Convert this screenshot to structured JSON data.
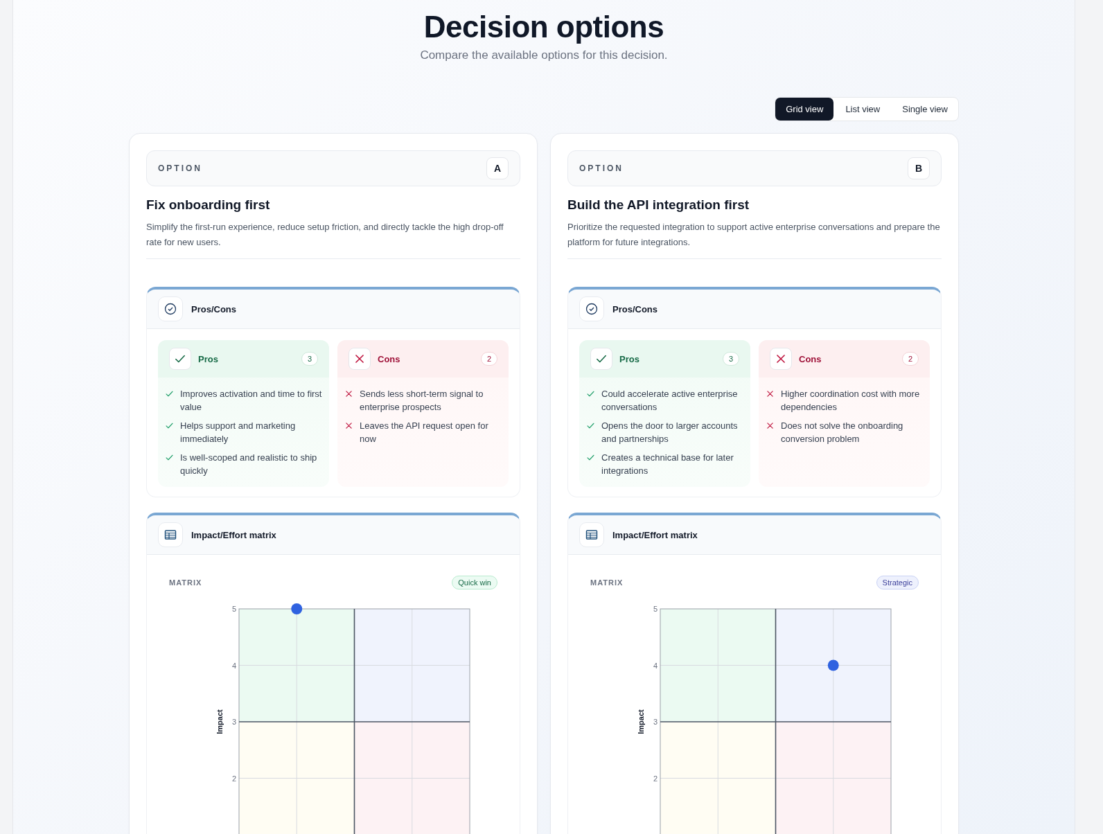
{
  "header": {
    "title": "Decision options",
    "subtitle": "Compare the available options for this decision."
  },
  "view_tabs": [
    {
      "label": "Grid view",
      "selected": true
    },
    {
      "label": "List view",
      "selected": false
    },
    {
      "label": "Single view",
      "selected": false
    }
  ],
  "options": [
    {
      "eyebrow": "OPTION",
      "letter": "A",
      "title": "Fix onboarding first",
      "description": "Simplify the first-run experience, reduce setup friction, and directly tackle the high drop-off rate for new users.",
      "pros_cons": {
        "title": "Pros/Cons",
        "pros": {
          "label": "Pros",
          "count": "3",
          "items": [
            "Improves activation and time to first value",
            "Helps support and marketing immediately",
            "Is well-scoped and realistic to ship quickly"
          ]
        },
        "cons": {
          "label": "Cons",
          "count": "2",
          "items": [
            "Sends less short-term signal to enterprise prospects",
            "Leaves the API request open for now"
          ]
        }
      },
      "matrix": {
        "title": "Impact/Effort matrix",
        "label": "MATRIX",
        "badge": {
          "text": "Quick win",
          "kind": "quick-win"
        },
        "chart_data": {
          "type": "scatter",
          "ylabel": "Impact",
          "categories": [
            null,
            null,
            null,
            null,
            null
          ],
          "series": [
            {
              "color": "#2f62e0",
              "values": [
                null,
                5,
                null,
                null,
                null
              ]
            }
          ],
          "ylim": [
            1,
            5
          ],
          "yticks": [
            2,
            3,
            4,
            5
          ],
          "grid": true
        }
      }
    },
    {
      "eyebrow": "OPTION",
      "letter": "B",
      "title": "Build the API integration first",
      "description": "Prioritize the requested integration to support active enterprise conversations and prepare the platform for future integrations.",
      "pros_cons": {
        "title": "Pros/Cons",
        "pros": {
          "label": "Pros",
          "count": "3",
          "items": [
            "Could accelerate active enterprise conversations",
            "Opens the door to larger accounts and partnerships",
            "Creates a technical base for later integrations"
          ]
        },
        "cons": {
          "label": "Cons",
          "count": "2",
          "items": [
            "Higher coordination cost with more dependencies",
            "Does not solve the onboarding conversion problem"
          ]
        }
      },
      "matrix": {
        "title": "Impact/Effort matrix",
        "label": "MATRIX",
        "badge": {
          "text": "Strategic",
          "kind": "strategic"
        },
        "chart_data": {
          "type": "scatter",
          "ylabel": "Impact",
          "categories": [
            null,
            null,
            null,
            null,
            null
          ],
          "series": [
            {
              "color": "#2f62e0",
              "values": [
                null,
                null,
                null,
                4,
                null
              ]
            }
          ],
          "ylim": [
            1,
            5
          ],
          "yticks": [
            2,
            3,
            4,
            5
          ],
          "grid": true
        }
      }
    }
  ]
}
